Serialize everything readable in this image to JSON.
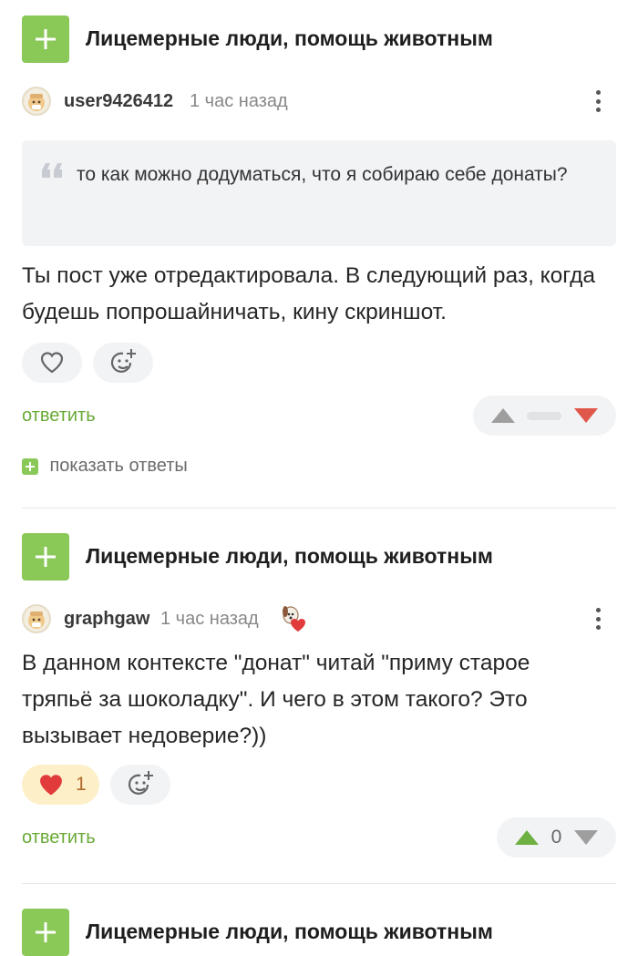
{
  "comments": [
    {
      "post_title": "Лицемерные люди, помощь животным",
      "username": "user9426412",
      "time": "1 час назад",
      "quote": "то как можно додуматься, что я собираю себе донаты?",
      "body": "Ты пост уже отредактировала. В следующий раз, когда будешь попрошайничать, кину скриншот.",
      "reply_label": "ответить",
      "show_replies_label": "показать ответы",
      "rating": ""
    },
    {
      "post_title": "Лицемерные люди, помощь животным",
      "username": "graphgaw",
      "time": "1 час назад",
      "body": "В данном контексте \"донат\" читай \"приму старое тряпьё за шоколадку\". И чего в этом такого? Это вызывает недоверие?))",
      "likes": "1",
      "reply_label": "ответить",
      "rating": "0"
    },
    {
      "post_title": "Лицемерные люди, помощь животным"
    }
  ],
  "colors": {
    "accent_green": "#8ac858",
    "reply_green": "#69aa37",
    "downvote_red": "#e0584c",
    "heart_red": "#e23b3b",
    "like_bg": "#fdf0c9"
  },
  "icons": {
    "plus": "plus-icon",
    "heart": "heart-icon",
    "emoji_add": "emoji-add-icon",
    "kebab": "more-vertical-icon",
    "quote": "quote-icon",
    "upvote": "triangle-up-icon",
    "downvote": "triangle-down-icon",
    "badge": "dog-heart-badge-icon"
  }
}
